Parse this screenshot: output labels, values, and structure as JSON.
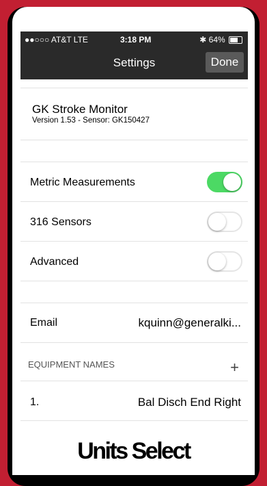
{
  "status_bar": {
    "carrier": "●●○○○ AT&T  LTE",
    "time": "3:18 PM",
    "battery": "✱ 64%"
  },
  "nav": {
    "title": "Settings",
    "done": "Done"
  },
  "app": {
    "name": "GK Stroke Monitor",
    "version": "Version 1.53 - Sensor: GK150427"
  },
  "toggles": [
    {
      "label": "Metric Measurements",
      "on": true
    },
    {
      "label": "316 Sensors",
      "on": false
    },
    {
      "label": "Advanced",
      "on": false
    }
  ],
  "email": {
    "label": "Email",
    "value": "kquinn@generalki..."
  },
  "equipment": {
    "header": "EQUIPMENT NAMES",
    "add": "+",
    "items": [
      {
        "index": "1.",
        "name": "Bal Disch End Right"
      }
    ]
  },
  "footer": "Units Select",
  "colors": {
    "frame": "#c21f32",
    "toggle_on": "#4cd964",
    "bar": "#2a2a2a"
  }
}
